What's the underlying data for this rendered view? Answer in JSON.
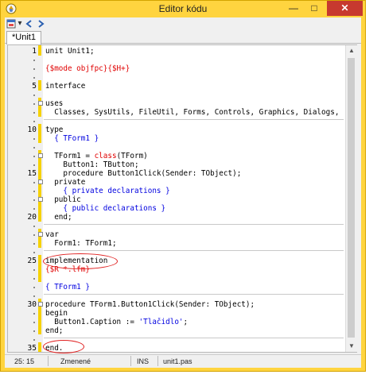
{
  "window": {
    "title": "Editor kódu"
  },
  "toolbar": {
    "buttons": [
      {
        "icon": "form-icon"
      },
      {
        "icon": "dropdown-icon"
      },
      {
        "icon": "back-arrow-icon"
      },
      {
        "icon": "forward-arrow-icon"
      }
    ]
  },
  "tabs": [
    {
      "label": "*Unit1"
    }
  ],
  "gutter": {
    "line_numbers": [
      "1",
      "5",
      "10",
      "15",
      "20",
      "25",
      "30",
      "35"
    ]
  },
  "code": {
    "l1": "unit Unit1;",
    "l3": "{$mode objfpc}{$H+}",
    "l5": "interface",
    "l7": "uses",
    "l8": "  Classes, SysUtils, FileUtil, Forms, Controls, Graphics, Dialogs, StdCtrls;",
    "l10": "type",
    "l11": "  { TForm1 }",
    "l13a": "  TForm1 = ",
    "l13b": "class",
    "l13c": "(TForm)",
    "l14": "    Button1: TButton;",
    "l15a": "    procedure ",
    "l15b": "Button1Click(Sender: TObject);",
    "l16": "  private",
    "l17": "    { private declarations }",
    "l18": "  public",
    "l19": "    { public declarations }",
    "l20": "  end;",
    "l22": "var",
    "l23": "  Form1: TForm1;",
    "l25": "implementation",
    "l26": "{$R *.lfm}",
    "l28": "{ TForm1 }",
    "l30a": "procedure ",
    "l30b": "TForm1.Button1Click(Sender: TObject);",
    "l31": "begin",
    "l32a": "  Button1.Caption := ",
    "l32b": "'Tlačidlo'",
    "l32c": ";",
    "l33": "end;",
    "l35": "end."
  },
  "status": {
    "position": "25: 15",
    "modified": "Zmenené",
    "mode": "INS",
    "file": "unit1.pas"
  },
  "colors": {
    "window_frame": "#ffd43f",
    "close_button": "#c7392f",
    "keyword": "#000000",
    "comment": "#0000e0",
    "directive": "#e00000",
    "annotation": "#e02020"
  }
}
